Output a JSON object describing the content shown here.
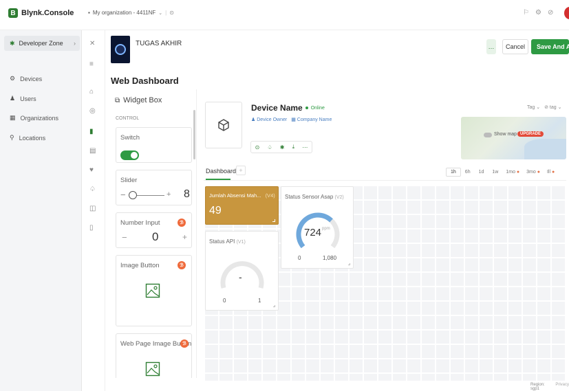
{
  "topbar": {
    "logo_letter": "B",
    "brand": "Blynk.Console",
    "org_selector": "My organization - 4411NF",
    "icons": [
      "bell-icon",
      "settings-icon",
      "help-icon"
    ],
    "brand_color": "#2e7d32"
  },
  "sidebar": {
    "zone_label": "Developer Zone",
    "items": [
      {
        "label": "Devices",
        "icon": "devices-icon"
      },
      {
        "label": "Users",
        "icon": "users-icon"
      },
      {
        "label": "Organizations",
        "icon": "organizations-icon"
      },
      {
        "label": "Locations",
        "icon": "locations-icon"
      }
    ]
  },
  "template": {
    "name": "TUGAS AKHIR",
    "cancel_label": "Cancel",
    "save_label": "Save And Apply",
    "more_label": "…",
    "section_title": "Web Dashboard"
  },
  "widget_box": {
    "title": "Widget Box",
    "category": "CONTROL",
    "widgets": [
      {
        "label": "Switch"
      },
      {
        "label": "Slider",
        "value": "8"
      },
      {
        "label": "Number Input",
        "value": "0"
      },
      {
        "label": "Image Button"
      },
      {
        "label": "Web Page Image Button"
      }
    ],
    "slider_minus": "−",
    "slider_plus": "+",
    "stepper_minus": "−",
    "stepper_plus": "+"
  },
  "device": {
    "name": "Device Name",
    "status": "Online",
    "owner_label": "Device Owner",
    "company_label": "Company Name",
    "tag_label": "Tag",
    "tag2_label": "tag",
    "show_map_label": "Show map",
    "upgrade_label": "UPGRADE"
  },
  "tabs": {
    "dashboard_label": "Dashboard",
    "add_label": "+",
    "time_ranges": [
      "1h",
      "6h",
      "1d",
      "1w",
      "1mo",
      "3mo",
      "Ill"
    ]
  },
  "widgets_on_dashboard": {
    "tile1": {
      "title": "Jumlah Absensi Mah...",
      "pin": "(V4)",
      "value": "49",
      "color": "#c8963e"
    },
    "tile2": {
      "title": "Status Sensor Asap",
      "pin": "(V2)",
      "value": "724",
      "unit": "ppm",
      "min": "0",
      "max": "1,080",
      "fill_fraction": 0.67,
      "arc_color": "#6fa8dc"
    },
    "tile3": {
      "title": "Status API",
      "pin": "(V1)",
      "value": "-",
      "min": "0",
      "max": "1",
      "fill_fraction": 0.0
    }
  },
  "footer": {
    "region": "Region: sgp1",
    "privacy": "Privacy"
  }
}
